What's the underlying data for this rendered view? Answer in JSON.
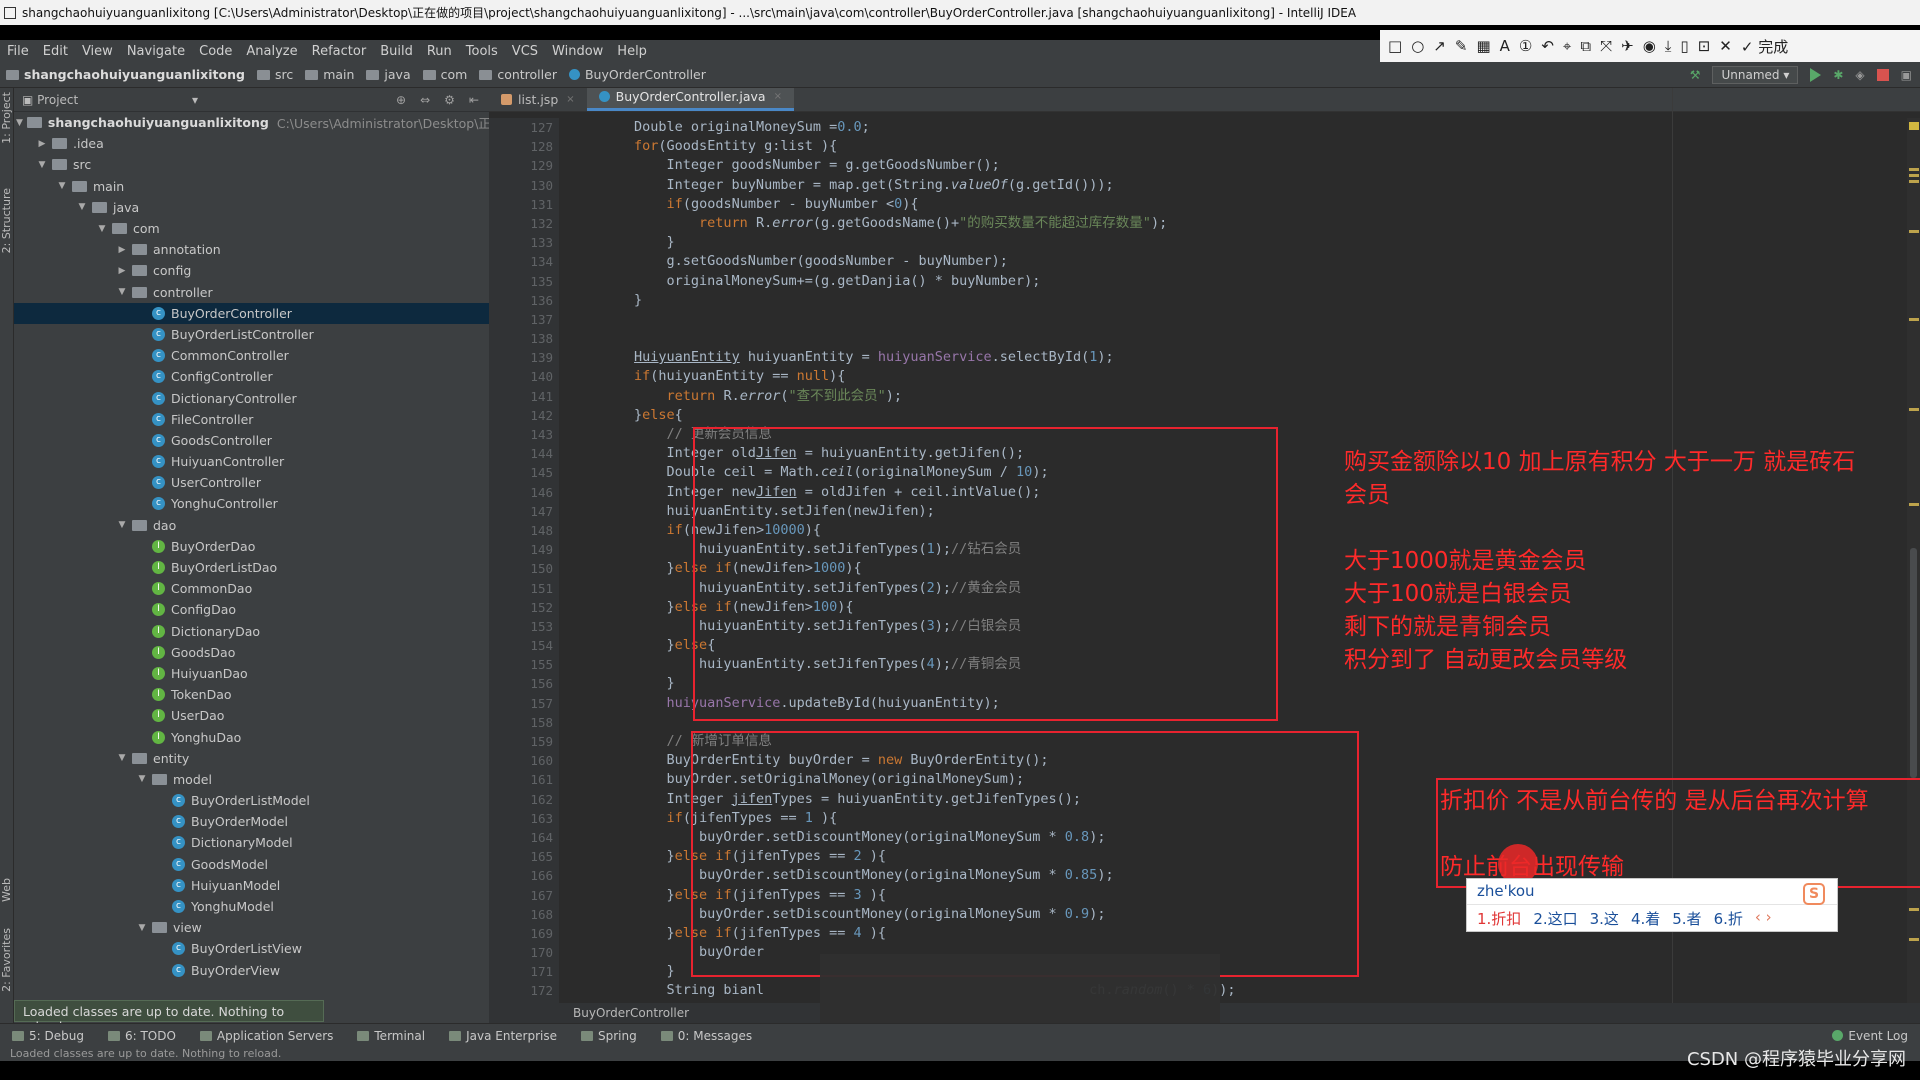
{
  "window": {
    "title": "shangchaohuiyuanguanlixitong [C:\\Users\\Administrator\\Desktop\\正在做的项目\\project\\shangchaohuiyuanguanlixitong] - ...\\src\\main\\java\\com\\controller\\BuyOrderController.java [shangchaohuiyuanguanlixitong] - IntelliJ IDEA"
  },
  "menu": [
    "File",
    "Edit",
    "View",
    "Navigate",
    "Code",
    "Analyze",
    "Refactor",
    "Build",
    "Run",
    "Tools",
    "VCS",
    "Window",
    "Help"
  ],
  "toolbar_right": {
    "finish_label": "完成"
  },
  "breadcrumb": [
    "shangchaohuiyuanguanlixitong",
    "src",
    "main",
    "java",
    "com",
    "controller",
    "BuyOrderController"
  ],
  "run": {
    "config": "Unnamed"
  },
  "side_tabs": {
    "project": "1: Project",
    "structure": "2: Structure",
    "web": "Web",
    "favorites": "2: Favorites"
  },
  "project_panel": {
    "header": "Project",
    "root_name": "shangchaohuiyuanguanlixitong",
    "root_path": "C:\\Users\\Administrator\\Desktop\\正在做",
    "items": [
      {
        "label": ".idea",
        "indent": 1,
        "kind": "folder",
        "open": false
      },
      {
        "label": "src",
        "indent": 1,
        "kind": "folder",
        "open": true
      },
      {
        "label": "main",
        "indent": 2,
        "kind": "folder",
        "open": true
      },
      {
        "label": "java",
        "indent": 3,
        "kind": "folder",
        "open": true
      },
      {
        "label": "com",
        "indent": 4,
        "kind": "folder",
        "open": true
      },
      {
        "label": "annotation",
        "indent": 5,
        "kind": "folder",
        "open": false
      },
      {
        "label": "config",
        "indent": 5,
        "kind": "folder",
        "open": false
      },
      {
        "label": "controller",
        "indent": 5,
        "kind": "folder",
        "open": true
      },
      {
        "label": "BuyOrderController",
        "indent": 6,
        "kind": "class",
        "selected": true
      },
      {
        "label": "BuyOrderListController",
        "indent": 6,
        "kind": "class"
      },
      {
        "label": "CommonController",
        "indent": 6,
        "kind": "class"
      },
      {
        "label": "ConfigController",
        "indent": 6,
        "kind": "class"
      },
      {
        "label": "DictionaryController",
        "indent": 6,
        "kind": "class"
      },
      {
        "label": "FileController",
        "indent": 6,
        "kind": "class"
      },
      {
        "label": "GoodsController",
        "indent": 6,
        "kind": "class"
      },
      {
        "label": "HuiyuanController",
        "indent": 6,
        "kind": "class"
      },
      {
        "label": "UserController",
        "indent": 6,
        "kind": "class"
      },
      {
        "label": "YonghuController",
        "indent": 6,
        "kind": "class"
      },
      {
        "label": "dao",
        "indent": 5,
        "kind": "folder",
        "open": true
      },
      {
        "label": "BuyOrderDao",
        "indent": 6,
        "kind": "interface"
      },
      {
        "label": "BuyOrderListDao",
        "indent": 6,
        "kind": "interface"
      },
      {
        "label": "CommonDao",
        "indent": 6,
        "kind": "interface"
      },
      {
        "label": "ConfigDao",
        "indent": 6,
        "kind": "interface"
      },
      {
        "label": "DictionaryDao",
        "indent": 6,
        "kind": "interface"
      },
      {
        "label": "GoodsDao",
        "indent": 6,
        "kind": "interface"
      },
      {
        "label": "HuiyuanDao",
        "indent": 6,
        "kind": "interface"
      },
      {
        "label": "TokenDao",
        "indent": 6,
        "kind": "interface"
      },
      {
        "label": "UserDao",
        "indent": 6,
        "kind": "interface"
      },
      {
        "label": "YonghuDao",
        "indent": 6,
        "kind": "interface"
      },
      {
        "label": "entity",
        "indent": 5,
        "kind": "folder",
        "open": true
      },
      {
        "label": "model",
        "indent": 6,
        "kind": "folder",
        "open": true
      },
      {
        "label": "BuyOrderListModel",
        "indent": 7,
        "kind": "class"
      },
      {
        "label": "BuyOrderModel",
        "indent": 7,
        "kind": "class"
      },
      {
        "label": "DictionaryModel",
        "indent": 7,
        "kind": "class"
      },
      {
        "label": "GoodsModel",
        "indent": 7,
        "kind": "class"
      },
      {
        "label": "HuiyuanModel",
        "indent": 7,
        "kind": "class"
      },
      {
        "label": "YonghuModel",
        "indent": 7,
        "kind": "class"
      },
      {
        "label": "view",
        "indent": 6,
        "kind": "folder",
        "open": true
      },
      {
        "label": "BuyOrderListView",
        "indent": 7,
        "kind": "class"
      },
      {
        "label": "BuyOrderView",
        "indent": 7,
        "kind": "class"
      }
    ],
    "notification": "Loaded classes are up to date. Nothing to reload."
  },
  "editor": {
    "tabs": [
      {
        "label": "list.jsp",
        "active": false
      },
      {
        "label": "BuyOrderController.java",
        "active": true
      }
    ],
    "first_line": 127,
    "bottom_breadcrumb": "BuyOrderController",
    "lines": [
      "        <span class=\"kw\"></span>Double originalMoneySum =<span class=\"num\">0.0</span>;",
      "        <span class=\"kw\">for</span>(GoodsEntity g:list ){",
      "            Integer goodsNumber = g.getGoodsNumber();",
      "            Integer buyNumber = map.get(String.<span class=\"it\">valueOf</span>(g.getId()));",
      "            <span class=\"kw\">if</span>(goodsNumber - buyNumber &lt;<span class=\"num\">0</span>){",
      "                <span class=\"kw\">return</span> R.<span class=\"it\">error</span>(g.getGoodsName()+<span class=\"str\">\"的购买数量不能超过库存数量\"</span>);",
      "            }",
      "            g.setGoodsNumber(goodsNumber - buyNumber);",
      "            originalMoneySum+=(g.getDanjia() * buyNumber);",
      "        }",
      "",
      "",
      "        <span class=\"ul\">HuiyuanEntity</span> huiyuanEntity = <span class=\"fld\">huiyuanService</span>.selectById(<span class=\"num\">1</span>);",
      "        <span class=\"kw\">if</span>(huiyuanEntity == <span class=\"kw\">null</span>){",
      "            <span class=\"kw\">return</span> R.<span class=\"it\">error</span>(<span class=\"str\">\"查不到此会员\"</span>);",
      "        }<span class=\"kw\">else</span>{",
      "            <span class=\"cm\">// 更新会员信息</span>",
      "            Integer old<span class=\"ul\">Jifen</span> = huiyuanEntity.getJifen();",
      "            Double ceil = Math.<span class=\"it\">ceil</span>(originalMoneySum / <span class=\"num\">10</span>);",
      "            Integer new<span class=\"ul\">Jifen</span> = oldJifen + ceil.intValue();",
      "            huiyuanEntity.setJifen(newJifen);",
      "            <span class=\"kw\">if</span>(newJifen&gt;<span class=\"num\">10000</span>){",
      "                huiyuanEntity.setJifenTypes(<span class=\"num\">1</span>);<span class=\"cm\">//钻石会员</span>",
      "            }<span class=\"kw\">else if</span>(newJifen&gt;<span class=\"num\">1000</span>){",
      "                huiyuanEntity.setJifenTypes(<span class=\"num\">2</span>);<span class=\"cm\">//黄金会员</span>",
      "            }<span class=\"kw\">else if</span>(newJifen&gt;<span class=\"num\">100</span>){",
      "                huiyuanEntity.setJifenTypes(<span class=\"num\">3</span>);<span class=\"cm\">//白银会员</span>",
      "            }<span class=\"kw\">else</span>{",
      "                huiyuanEntity.setJifenTypes(<span class=\"num\">4</span>);<span class=\"cm\">//青铜会员</span>",
      "            }",
      "            <span class=\"fld\">huiyuanService</span>.updateById(huiyuanEntity);",
      "",
      "            <span class=\"cm\">// 新增订单信息</span>",
      "            BuyOrderEntity buyOrder = <span class=\"kw\">new</span> BuyOrderEntity();",
      "            buyOrder.setOriginalMoney(originalMoneySum);",
      "            Integer <span class=\"ul\">jifen</span>Types = huiyuanEntity.getJifenTypes();",
      "            <span class=\"kw\">if</span>(jifenTypes == <span class=\"num\">1</span> ){",
      "                buyOrder.setDiscountMoney(originalMoneySum * <span class=\"num\">0.8</span>);",
      "            }<span class=\"kw\">else if</span>(jifenTypes == <span class=\"num\">2</span> ){",
      "                buyOrder.setDiscountMoney(originalMoneySum * <span class=\"num\">0.85</span>);",
      "            }<span class=\"kw\">else if</span>(jifenTypes == <span class=\"num\">3</span> ){",
      "                buyOrder.setDiscountMoney(originalMoneySum * <span class=\"num\">0.9</span>);",
      "            }<span class=\"kw\">else if</span>(jifenTypes == <span class=\"num\">4</span> ){",
      "                buyOrder                                         ",
      "            }",
      "            String bianl                                        ch.<span class=\"it\">random</span>() * <span class=\"num\">6</span>));"
    ]
  },
  "annotations": {
    "box1_text": [
      "购买金额除以10  加上原有积分  大于一万 就是砖石",
      "会员",
      "",
      "大于1000就是黄金会员",
      "大于100就是白银会员",
      "剩下的就是青铜会员",
      "积分到了 自动更改会员等级"
    ],
    "box2_text": [
      "折扣价 不是从前台传的 是从后台再次计算",
      "",
      "防止前台出现传输"
    ]
  },
  "ime": {
    "composition": "zhe'kou",
    "candidates": [
      "1.折扣",
      "2.这口",
      "3.这",
      "4.着",
      "5.者",
      "6.折"
    ],
    "logo": "S"
  },
  "tool_windows": {
    "left": [
      {
        "label": "5: Debug",
        "icon": "debug-icon"
      },
      {
        "label": "6: TODO",
        "icon": "todo-icon"
      },
      {
        "label": "Application Servers",
        "icon": "server-icon"
      },
      {
        "label": "Terminal",
        "icon": "terminal-icon"
      },
      {
        "label": "Java Enterprise",
        "icon": "java-enterprise-icon"
      },
      {
        "label": "Spring",
        "icon": "spring-icon"
      },
      {
        "label": "0: Messages",
        "icon": "messages-icon"
      }
    ],
    "event_log": "Event Log"
  },
  "statusbar": {
    "text": "Loaded classes are up to date. Nothing to reload."
  },
  "watermark": "CSDN @程序猿毕业分享网"
}
